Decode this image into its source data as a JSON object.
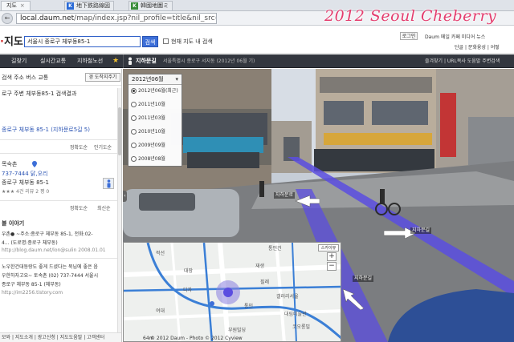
{
  "browser": {
    "tabs": [
      {
        "label": "지도"
      },
      {
        "label": "地下鉄路線図"
      },
      {
        "label": "韓國地圖ミ"
      }
    ],
    "url": {
      "host": "local.daum.net",
      "path": "/map/index.jsp?nil_profile=title&nil_src=local"
    }
  },
  "watermark": "2012 Seoul Cheberry",
  "header": {
    "logo_text": "지도",
    "search_value": "서울시 종로구 체부동85-1",
    "search_button": "검색",
    "scope_label": "현재 지도 내 검색",
    "login_label": "로그인",
    "service_links": "Daum  메일  카페  미디어  뉴스",
    "sub_links": "단골 | 문화융성  | 어떻"
  },
  "nav": {
    "items": [
      "길찾기",
      "실시간교통",
      "지하철노선"
    ],
    "roadview_label": "지하문길",
    "roadview_notice": "서울특별시 종로구 서지동 (2012년 06월 기)",
    "right_links": "즐겨찾기 | URL복사  도움말  주변검색"
  },
  "left_panel": {
    "categories": "검색   주소   버스   교통",
    "route_button": "경 도착지주기",
    "result_title": "로구 주변 체부동85-1 검색결과",
    "result_address": "종로구 체부동 85-1 (지하문로5길 5)",
    "sort_a": "정확도순",
    "sort_b": "인기도순",
    "place_phone": "737-7444 닭,오리",
    "place_name": "목숙촌",
    "place_address": "종로구 체부동 85-1",
    "place_rating": "★★★  4건  리뷰 2  평 0",
    "sort_c": "정확도순",
    "sort_d": "최신순",
    "blog_title": "블 이야기",
    "blog_line1": "우촌● ~주소:종로구 체부동 85-1, 전화:02-",
    "blog_line2": "4...  (도로명:종로구 체부동)",
    "blog_url": "http://blog.daum.net/lon@sulin   2008.01.01",
    "post_line1": "노우한건대동랑도 좋게 드셨다는 북님에 좋은 음",
    "post_line2": "우한하자고요~ 토속촌 (02) 737-7444 서울시",
    "post_line3": "종로구 체부동 85-1 (체부동)",
    "post_url": "http://im2256.tistory.com",
    "bottom_links": "모와 | 지도소개 | 광고신청 | 지도도움말 | 고객센터"
  },
  "date_select": {
    "selected_label": "2012년06월",
    "options": [
      {
        "label": "2012년06월(최근)",
        "selected": true
      },
      {
        "label": "2011년10월",
        "selected": false
      },
      {
        "label": "2011년03월",
        "selected": false
      },
      {
        "label": "2010년10월",
        "selected": false
      },
      {
        "label": "2009년09월",
        "selected": false
      },
      {
        "label": "2008년08월",
        "selected": false
      }
    ]
  },
  "street_labels": {
    "sign_a": "자하문로",
    "sign_b": "지하문길",
    "sign_c": "지하문길"
  },
  "minimap": {
    "map_type": "스카이뷰",
    "copyright": "© 2012 Daum - Photo © 2012 Cyview",
    "scale": "64m",
    "labels": [
      "적선",
      "대장",
      "디자",
      "재생",
      "필례",
      "갤러리서울",
      "여대",
      "통인",
      "대림미술관",
      "부원빌딩",
      "코오롱빌",
      "통인건"
    ]
  },
  "colors": {
    "accent": "#3d6fd8",
    "nav_bg": "#33373f",
    "route_line": "#5b4de0",
    "watermark": "#e43d6e"
  }
}
